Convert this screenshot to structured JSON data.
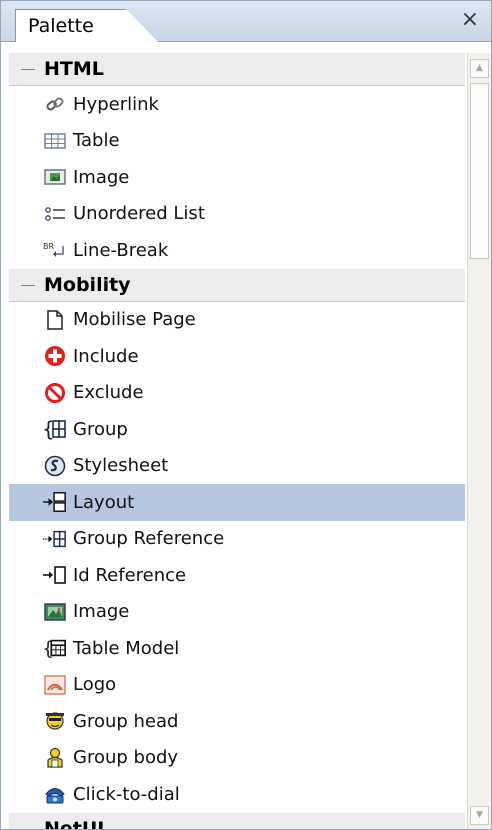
{
  "window": {
    "tab_label": "Palette",
    "close_glyph": "×"
  },
  "sections": [
    {
      "title": "HTML",
      "items": [
        {
          "label": "Hyperlink",
          "icon": "hyperlink-icon"
        },
        {
          "label": "Table",
          "icon": "table-icon"
        },
        {
          "label": "Image",
          "icon": "image-icon"
        },
        {
          "label": "Unordered List",
          "icon": "unordered-list-icon"
        },
        {
          "label": "Line-Break",
          "icon": "line-break-icon"
        }
      ]
    },
    {
      "title": "Mobility",
      "items": [
        {
          "label": "Mobilise Page",
          "icon": "page-icon"
        },
        {
          "label": "Include",
          "icon": "include-icon"
        },
        {
          "label": "Exclude",
          "icon": "exclude-icon"
        },
        {
          "label": "Group",
          "icon": "group-icon"
        },
        {
          "label": "Stylesheet",
          "icon": "stylesheet-icon"
        },
        {
          "label": "Layout",
          "icon": "layout-icon",
          "selected": true
        },
        {
          "label": "Group Reference",
          "icon": "group-reference-icon"
        },
        {
          "label": "Id Reference",
          "icon": "id-reference-icon"
        },
        {
          "label": "Image",
          "icon": "mobility-image-icon"
        },
        {
          "label": "Table Model",
          "icon": "table-model-icon"
        },
        {
          "label": "Logo",
          "icon": "logo-icon"
        },
        {
          "label": "Group head",
          "icon": "group-head-icon"
        },
        {
          "label": "Group body",
          "icon": "group-body-icon"
        },
        {
          "label": "Click-to-dial",
          "icon": "click-to-dial-icon"
        }
      ]
    },
    {
      "title": "NetUI",
      "items": []
    }
  ],
  "colors": {
    "selected_row": "#b6c6e0",
    "category_bg": "#ececec",
    "tabbar": "#d3ddeb"
  }
}
